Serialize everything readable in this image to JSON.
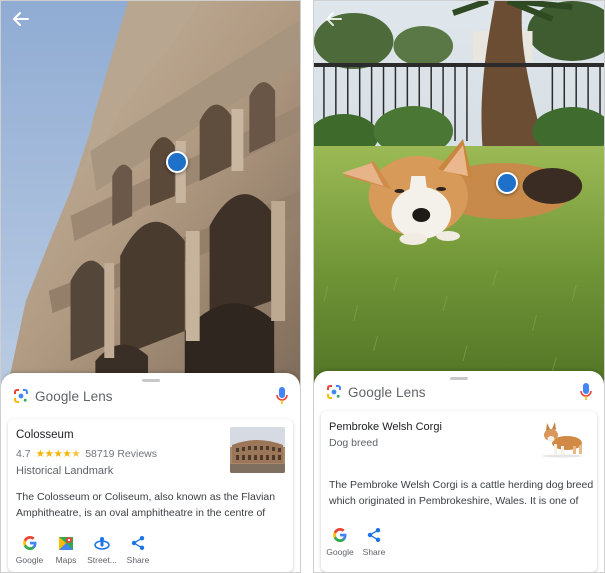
{
  "lens_brand": "Google Lens",
  "left_screen": {
    "result": {
      "title": "Colosseum",
      "rating": "4.7",
      "stars": "★★★★★",
      "stars_value": 4.7,
      "reviews": "58719 Reviews",
      "category": "Historical Landmark",
      "description": "The Colosseum or Coliseum, also known as the Flavian Amphitheatre, is an oval amphitheatre in the centre of the..."
    },
    "actions": [
      {
        "label": "Google",
        "icon": "google-icon"
      },
      {
        "label": "Maps",
        "icon": "maps-icon"
      },
      {
        "label": "Street...",
        "icon": "street-view-icon"
      },
      {
        "label": "Share",
        "icon": "share-icon"
      }
    ]
  },
  "right_screen": {
    "result": {
      "title": "Pembroke Welsh Corgi",
      "category": "Dog breed",
      "description": "The Pembroke Welsh Corgi is a cattle herding dog breed which originated in Pembrokeshire, Wales. It is one of two..."
    },
    "actions": [
      {
        "label": "Google",
        "icon": "google-icon"
      },
      {
        "label": "Share",
        "icon": "share-icon"
      }
    ]
  },
  "colors": {
    "pin": "#1e70c8",
    "star": "#f4b400",
    "google_blue": "#4285f4",
    "google_red": "#ea4335",
    "google_yellow": "#fbbc05",
    "google_green": "#34a853",
    "action_blue": "#1a73e8"
  }
}
